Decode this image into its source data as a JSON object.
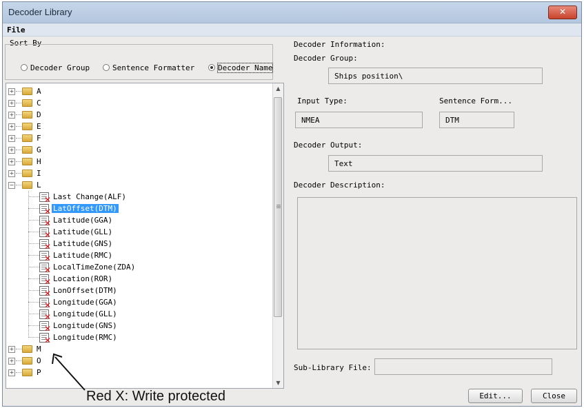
{
  "window": {
    "title": "Decoder Library",
    "close_glyph": "✕"
  },
  "menu": {
    "file": "File"
  },
  "sort": {
    "label": "Sort By",
    "options": [
      {
        "label": "Decoder Group",
        "selected": false
      },
      {
        "label": "Sentence Formatter",
        "selected": false
      },
      {
        "label": "Decoder Name",
        "selected": true
      }
    ]
  },
  "tree": {
    "folders_top": [
      "A",
      "C",
      "D",
      "E",
      "F",
      "G",
      "H",
      "I"
    ],
    "expanded_folder": "L",
    "leaves": [
      "Last Change(ALF)",
      "LatOffset(DTM)",
      "Latitude(GGA)",
      "Latitude(GLL)",
      "Latitude(GNS)",
      "Latitude(RMC)",
      "LocalTimeZone(ZDA)",
      "Location(ROR)",
      "LonOffset(DTM)",
      "Longitude(GGA)",
      "Longitude(GLL)",
      "Longitude(GNS)",
      "Longitude(RMC)"
    ],
    "selected_leaf": "LatOffset(DTM)",
    "folders_bottom": [
      "M",
      "O",
      "P"
    ],
    "expand_glyph": "+",
    "collapse_glyph": "−",
    "write_protected_glyph": "✕"
  },
  "info": {
    "section": "Decoder Information:",
    "group_label": "Decoder Group:",
    "group_value": "Ships position\\",
    "input_type_label": "Input Type:",
    "input_type_value": "NMEA",
    "sentence_label": "Sentence Form...",
    "sentence_value": "DTM",
    "output_label": "Decoder Output:",
    "output_value": "Text",
    "description_label": "Decoder Description:",
    "description_value": "",
    "sublibrary_label": "Sub-Library File:",
    "sublibrary_value": ""
  },
  "buttons": {
    "edit": "Edit...",
    "close": "Close"
  },
  "annotation": "Red X: Write protected"
}
